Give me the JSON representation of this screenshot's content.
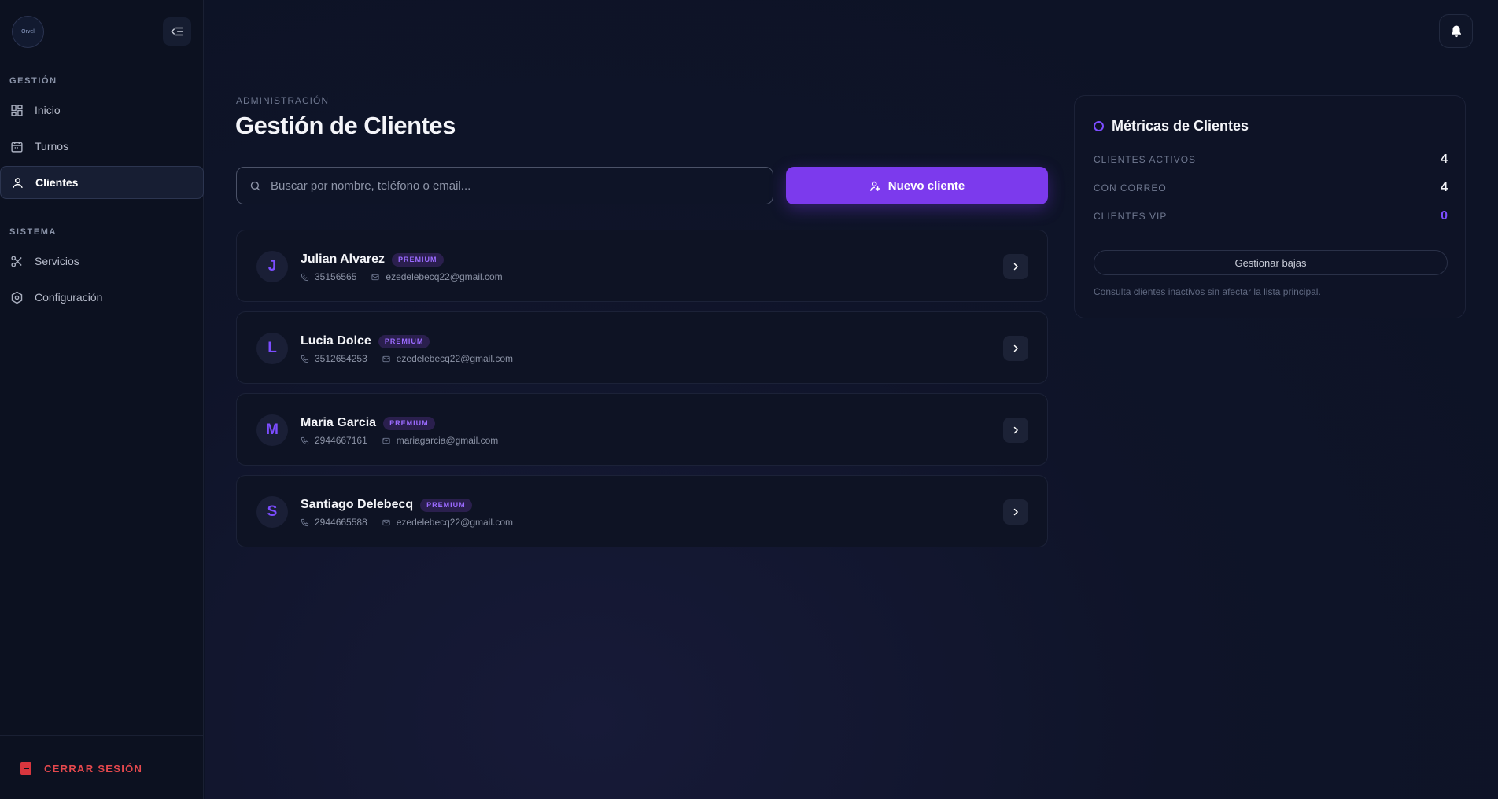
{
  "app": {
    "logo_text": "Orvel"
  },
  "sidebar": {
    "sections": [
      {
        "label": "GESTIÓN",
        "items": [
          {
            "label": "Inicio",
            "icon": "grid-icon"
          },
          {
            "label": "Turnos",
            "icon": "calendar-icon"
          },
          {
            "label": "Clientes",
            "icon": "user-icon",
            "active": true
          }
        ]
      },
      {
        "label": "SISTEMA",
        "items": [
          {
            "label": "Servicios",
            "icon": "scissors-icon"
          },
          {
            "label": "Configuración",
            "icon": "settings-icon"
          }
        ]
      }
    ],
    "logout_label": "CERRAR SESIÓN"
  },
  "header": {
    "overline": "ADMINISTRACIÓN",
    "title": "Gestión de Clientes"
  },
  "search": {
    "placeholder": "Buscar por nombre, teléfono o email...",
    "value": ""
  },
  "new_client_label": "Nuevo cliente",
  "clients": [
    {
      "initial": "J",
      "name": "Julian Alvarez",
      "badge": "PREMIUM",
      "phone": "35156565",
      "email": "ezedelebecq22@gmail.com"
    },
    {
      "initial": "L",
      "name": "Lucia Dolce",
      "badge": "PREMIUM",
      "phone": "3512654253",
      "email": "ezedelebecq22@gmail.com"
    },
    {
      "initial": "M",
      "name": "Maria Garcia",
      "badge": "PREMIUM",
      "phone": "2944667161",
      "email": "mariagarcia@gmail.com"
    },
    {
      "initial": "S",
      "name": "Santiago Delebecq",
      "badge": "PREMIUM",
      "phone": "2944665588",
      "email": "ezedelebecq22@gmail.com"
    }
  ],
  "metrics": {
    "title": "Métricas de Clientes",
    "rows": [
      {
        "label": "CLIENTES ACTIVOS",
        "value": "4"
      },
      {
        "label": "CON CORREO",
        "value": "4"
      },
      {
        "label": "CLIENTES VIP",
        "value": "0"
      }
    ],
    "bajas_label": "Gestionar bajas",
    "note": "Consulta clientes inactivos sin afectar la lista principal."
  },
  "colors": {
    "accent": "#7c3aed",
    "danger": "#e5484d",
    "background": "#0d1326"
  }
}
